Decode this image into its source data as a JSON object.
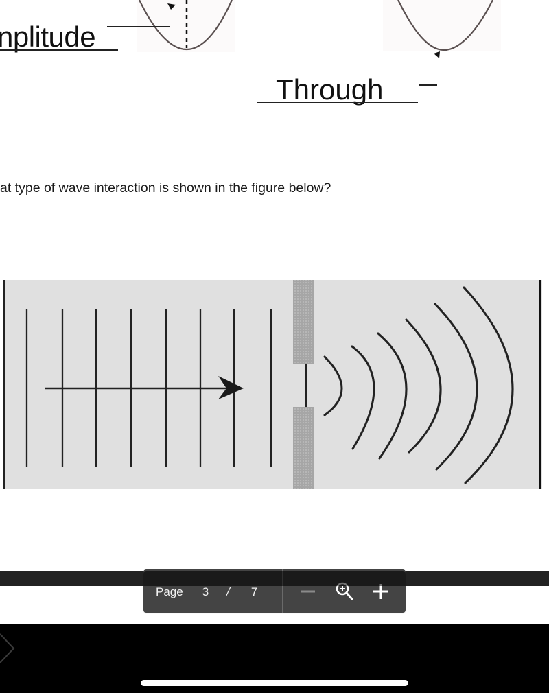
{
  "document": {
    "wave_labels": {
      "amplitude": "nplitude",
      "trough": "Through"
    },
    "question_text": "at type of wave interaction is shown in the figure below?",
    "figure": {
      "description": "Diffraction: plane waves passing through a narrow slit and spreading as circular wavefronts",
      "plane_wavefront_count": 8,
      "circular_wavefront_count": 6,
      "background_color": "#e0e0e0",
      "barrier_color": "#a8a8a8",
      "line_color": "#222222"
    }
  },
  "toolbar": {
    "page_label": "Page",
    "current_page": "3",
    "separator": "/",
    "total_pages": "7",
    "zoom_out_icon": "minus-icon",
    "zoom_icon": "zoom-in-magnifier-icon",
    "zoom_in_icon": "plus-icon"
  },
  "navigation": {
    "next_icon": "chevron-right-icon"
  }
}
